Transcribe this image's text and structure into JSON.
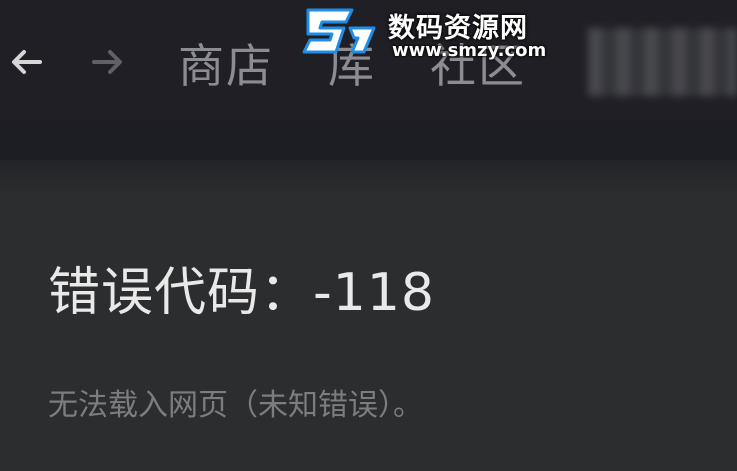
{
  "nav": {
    "back_icon": "arrow-left-icon",
    "forward_icon": "arrow-right-icon",
    "tabs": [
      {
        "label": "商店"
      },
      {
        "label": "库"
      },
      {
        "label": "社区"
      }
    ]
  },
  "watermark": {
    "logo_icon": "site-logo-icon",
    "title": "数码资源网",
    "url": "www.smzy.com"
  },
  "error": {
    "title": "错误代码：-118",
    "message": "无法载入网页（未知错误）。"
  },
  "colors": {
    "topbar": "#1f1f25",
    "page": "#2b2d2e",
    "title_text": "#e9e9e9",
    "muted_text": "#7b7d80",
    "watermark_blue": "#1f8ce6"
  }
}
